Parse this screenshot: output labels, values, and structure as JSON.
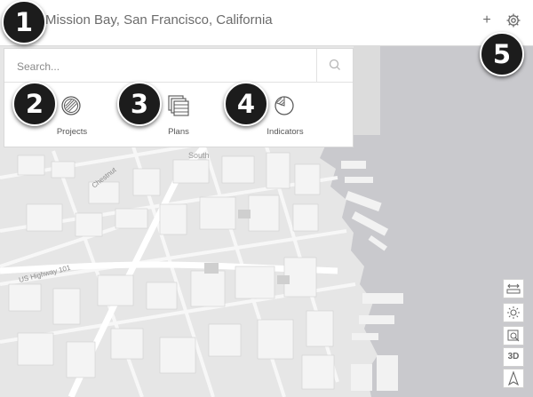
{
  "scene": {
    "title": "Mission Bay, San Francisco, California",
    "add_icon": "plus-icon",
    "settings_icon": "gear-icon"
  },
  "search": {
    "placeholder": "Search...",
    "icon": "search-icon"
  },
  "tools": [
    {
      "label": "Projects",
      "icon": "projects-icon"
    },
    {
      "label": "Plans",
      "icon": "plans-icon"
    },
    {
      "label": "Indicators",
      "icon": "indicators-icon"
    }
  ],
  "callouts": [
    "1",
    "2",
    "3",
    "4",
    "5"
  ],
  "map_labels": {
    "street_1": "Chestnut",
    "street_2": "US Highway 101",
    "district": "South"
  },
  "map_tools": [
    {
      "icon": "measure-icon"
    },
    {
      "icon": "daylight-icon"
    },
    {
      "icon": "slice-icon"
    },
    {
      "label": "3D"
    },
    {
      "icon": "compass-icon"
    }
  ],
  "colors": {
    "water": "#c9c9cd",
    "land": "#e6e6e6",
    "callout": "#1c1c1c",
    "topbar": "#ffffff"
  }
}
